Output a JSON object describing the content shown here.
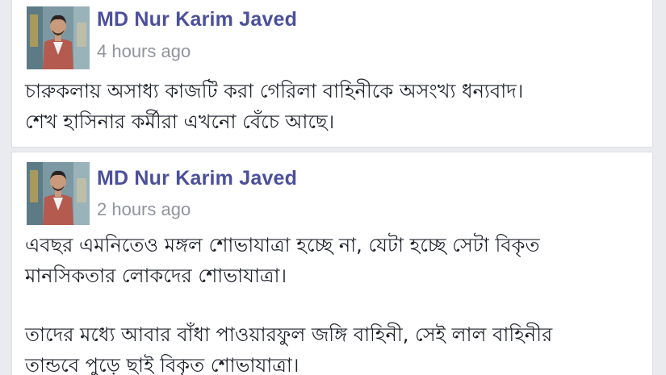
{
  "posts": [
    {
      "author": "MD Nur Karim Javed",
      "time": "4 hours ago",
      "lines": [
        "চারুকলায় অসাধ্য কাজটি করা গেরিলা বাহিনীকে অসংখ্য ধন্যবাদ।",
        "শেখ হাসিনার কর্মীরা এখনো বেঁচে আছে।"
      ]
    },
    {
      "author": "MD Nur Karim Javed",
      "time": "2 hours ago",
      "lines": [
        "এবছর এমনিতেও মঙ্গল শোভাযাত্রা হচ্ছে না, যেটা হচ্ছে সেটা বিকৃত",
        "মানসিকতার লোকদের শোভাযাত্রা।",
        "তাদের মধ্যে আবার বাঁধা পাওয়ারফুল জঙ্গি বাহিনী, সেই লাল বাহিনীর",
        "তান্ডবে পুড়ে ছাই বিকৃত শোভাযাত্রা।"
      ]
    }
  ],
  "colors": {
    "author": "#4b4f9c",
    "timestamp": "#90949c",
    "text": "#1d2129",
    "background": "#e9ebee"
  }
}
